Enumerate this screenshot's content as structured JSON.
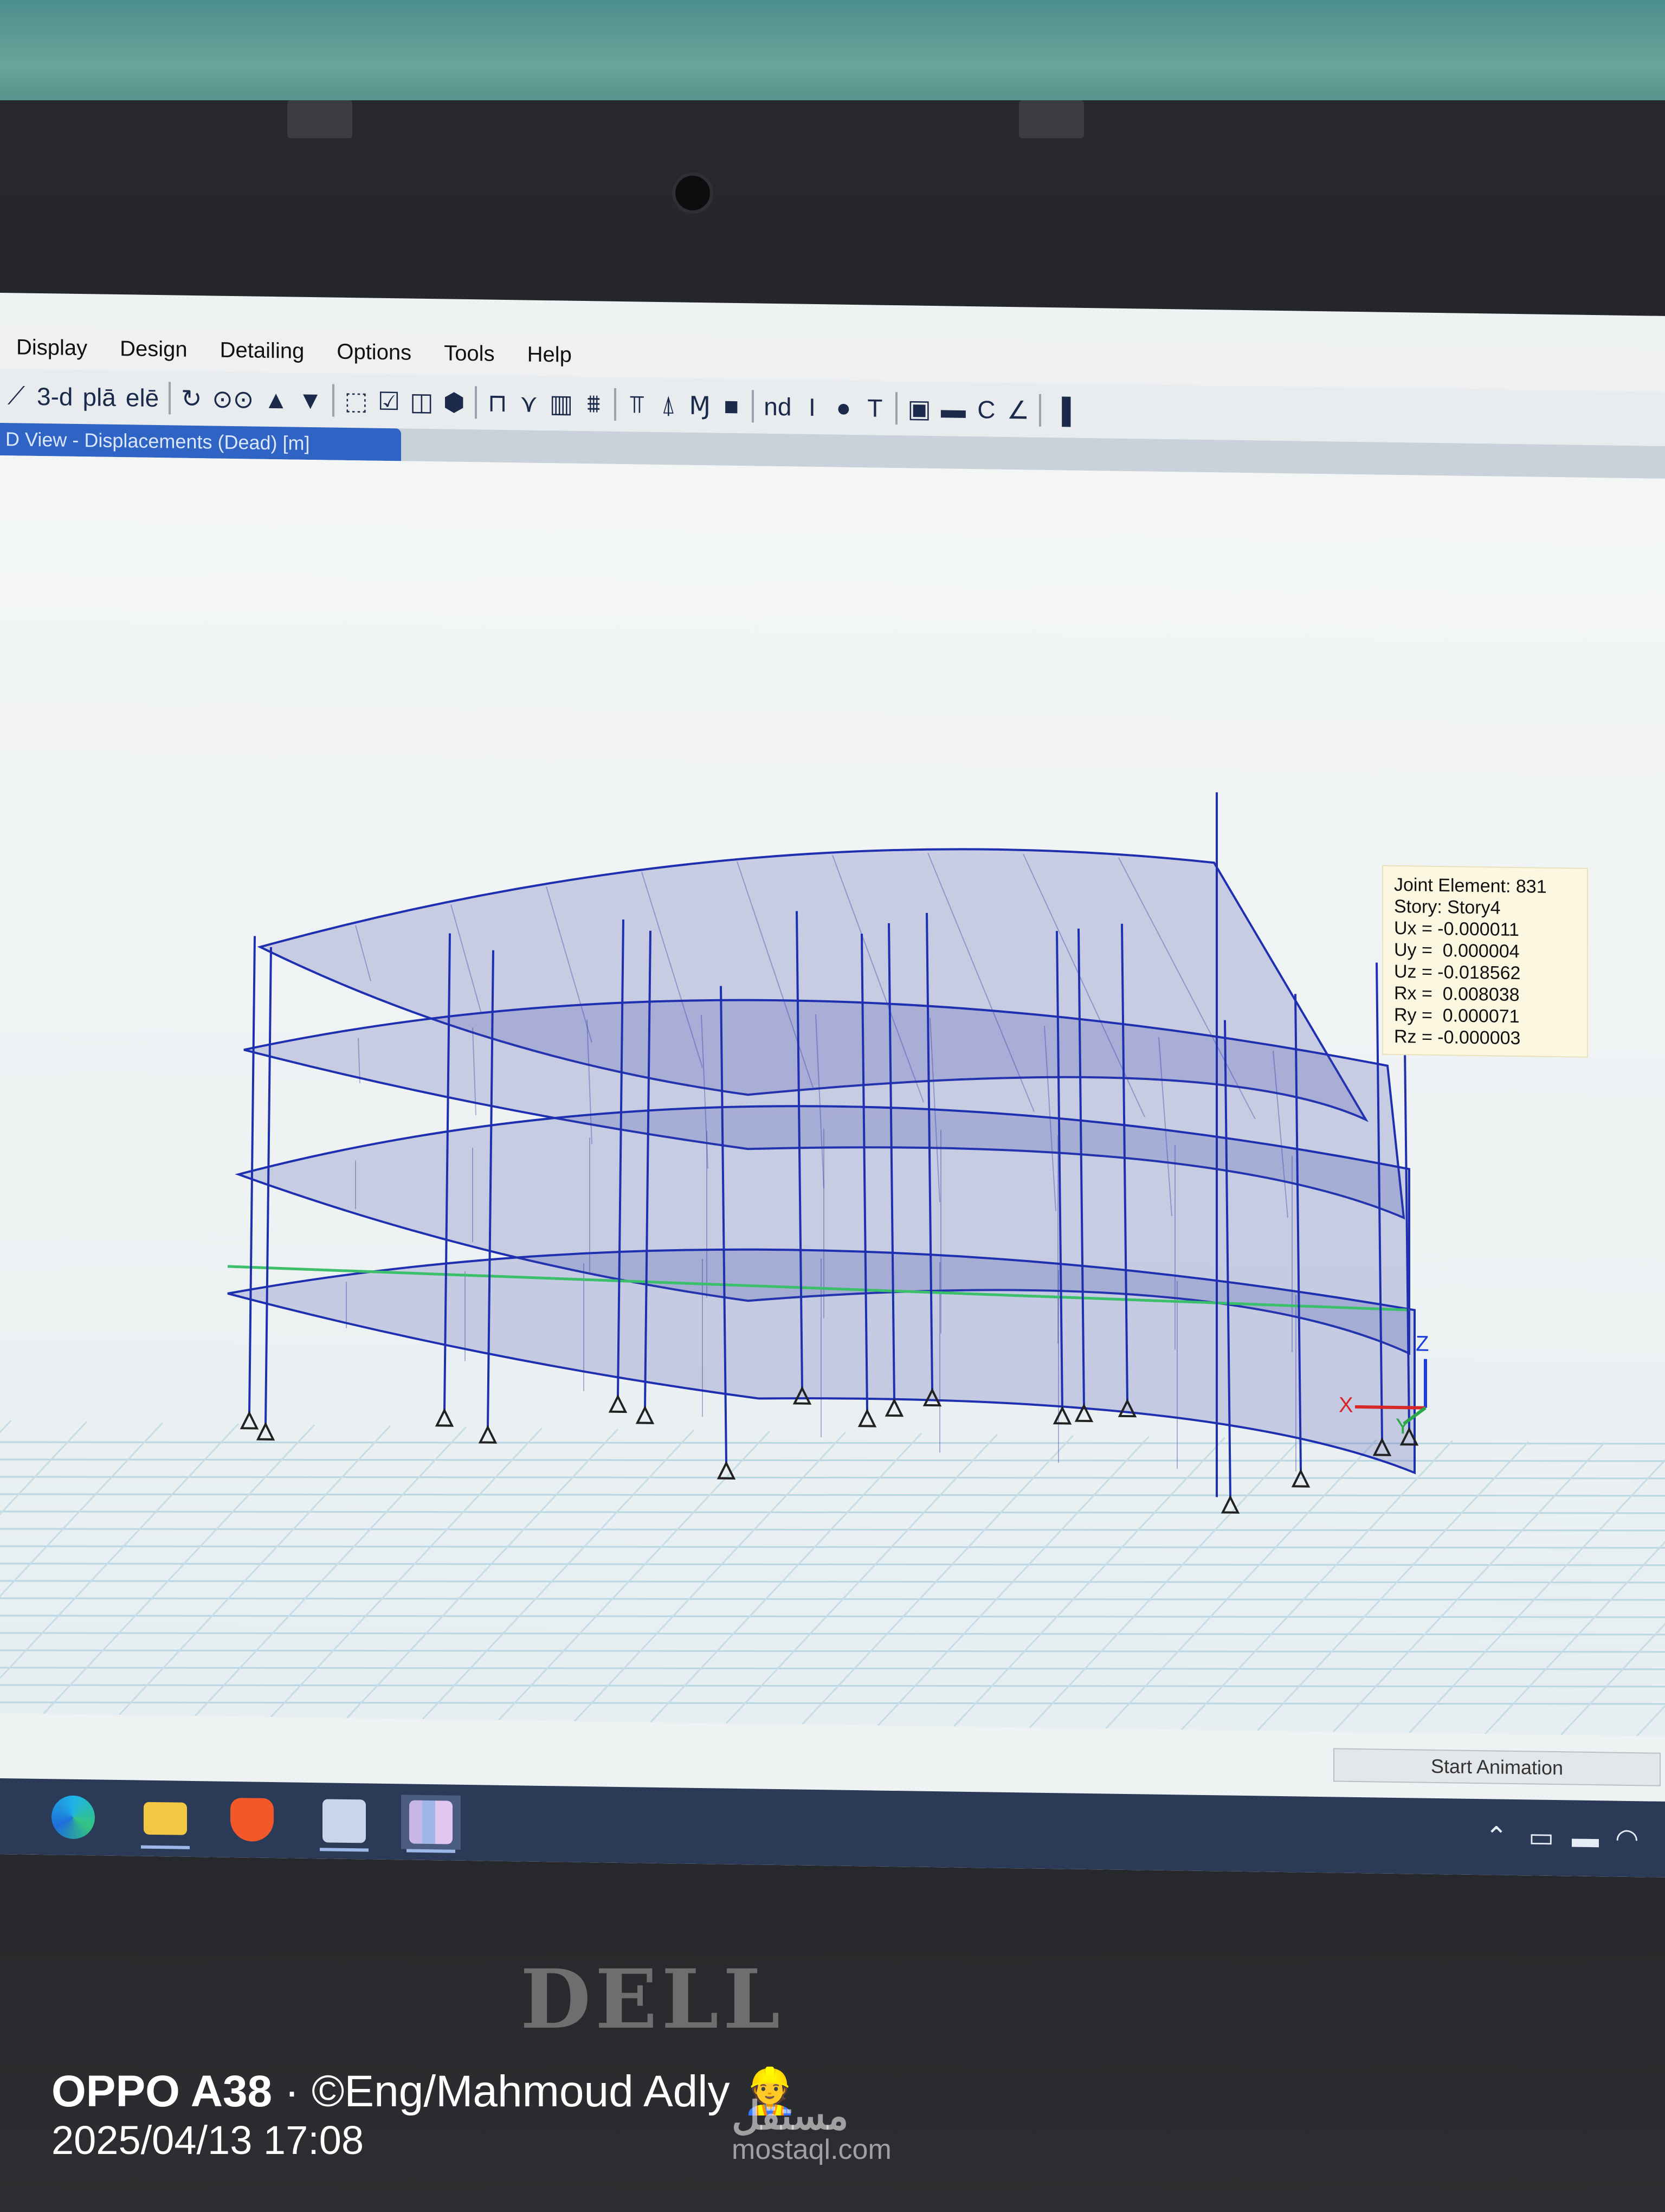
{
  "menu": [
    "Display",
    "Design",
    "Detailing",
    "Options",
    "Tools",
    "Help"
  ],
  "toolbar": {
    "items": [
      {
        "name": "draw-icon",
        "glyph": "⟋"
      },
      {
        "name": "view-3d-button",
        "glyph": "3-d"
      },
      {
        "name": "plan-view-button",
        "glyph": "plā"
      },
      {
        "name": "elevation-view-button",
        "glyph": "elē"
      },
      {
        "name": "rotate-icon",
        "glyph": "↻"
      },
      {
        "name": "glasses-icon",
        "glyph": "⊙⊙"
      },
      {
        "name": "up-arrow-icon",
        "glyph": "▲"
      },
      {
        "name": "down-arrow-icon",
        "glyph": "▼"
      },
      {
        "name": "select-icon",
        "glyph": "⬚"
      },
      {
        "name": "checkbox-icon",
        "glyph": "☑"
      },
      {
        "name": "box-icon",
        "glyph": "◫"
      },
      {
        "name": "shape-icon",
        "glyph": "⬢"
      },
      {
        "name": "frame-icon",
        "glyph": "⊓"
      },
      {
        "name": "brace-icon",
        "glyph": "⋎"
      },
      {
        "name": "wall-icon",
        "glyph": "▥"
      },
      {
        "name": "stair-icon",
        "glyph": "⩩"
      },
      {
        "name": "frame-load-icon",
        "glyph": "⫪"
      },
      {
        "name": "support-icon",
        "glyph": "⍋"
      },
      {
        "name": "moment-icon",
        "glyph": "Ɱ"
      },
      {
        "name": "fill-icon",
        "glyph": "■"
      },
      {
        "name": "end-label",
        "glyph": "nd"
      },
      {
        "name": "beam-section-icon",
        "glyph": "I"
      },
      {
        "name": "circle-section-icon",
        "glyph": "●"
      },
      {
        "name": "tee-section-icon",
        "glyph": "T"
      },
      {
        "name": "box-section-icon",
        "glyph": "▣"
      },
      {
        "name": "hatch-icon",
        "glyph": "▬"
      },
      {
        "name": "channel-section-icon",
        "glyph": "C"
      },
      {
        "name": "angle-section-icon",
        "glyph": "∠"
      },
      {
        "name": "plate-icon",
        "glyph": "▐"
      }
    ]
  },
  "tab": {
    "title": "D View - Displacements (Dead) [m]"
  },
  "tooltip": {
    "lines": [
      "Joint Element: 831",
      "Story: Story4",
      "Ux = -0.000011",
      "Uy =  0.000004",
      "Uz = -0.018562",
      "Rx =  0.008038",
      "Ry =  0.000071",
      "Rz = -0.000003"
    ]
  },
  "axes": {
    "x": "X",
    "y": "Y",
    "z": "Z"
  },
  "start_animation": "Start Animation",
  "taskbar": {
    "apps": [
      "edge-icon",
      "file-explorer-icon",
      "brave-icon",
      "calculator-icon",
      "etabs-icon"
    ],
    "tray": [
      "chevron-up-icon",
      "display-icon",
      "battery-icon",
      "wifi-icon"
    ]
  },
  "colors": {
    "model": "#1e2fb0",
    "tab": "#2f63c4",
    "taskbar": "#2b3a57",
    "tooltip": "#fbf7e1"
  },
  "laptop_brand": "DELL",
  "photo_overlay": {
    "device": "OPPO A38",
    "credit": " · ©Eng/Mahmoud Adly 👷",
    "timestamp": "2025/04/13 17:08",
    "watermark": "مستقل",
    "watermark_url": "mostaql.com"
  }
}
